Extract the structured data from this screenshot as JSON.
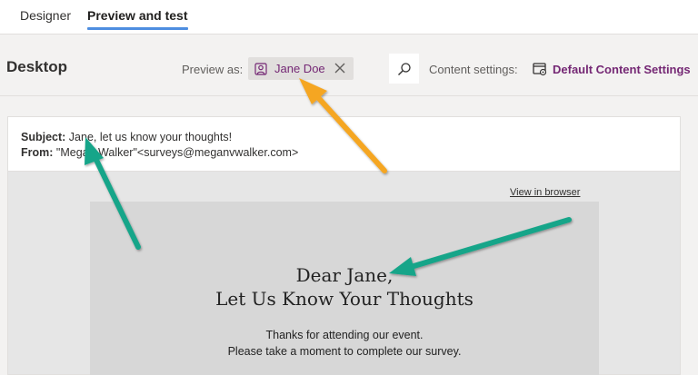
{
  "tabs": [
    {
      "label": "Designer"
    },
    {
      "label": "Preview and test",
      "active": true
    }
  ],
  "toolbar": {
    "device_title": "Desktop",
    "preview_as_label": "Preview as:",
    "persona_name": "Jane Doe",
    "content_settings_label": "Content settings:",
    "content_settings_value": "Default Content Settings"
  },
  "email": {
    "subject_label": "Subject:",
    "subject_value": "Jane, let us know your thoughts!",
    "from_label": "From:",
    "from_value": "\"Megan Walker\"<surveys@meganvwalker.com>",
    "view_in_browser": "View in browser",
    "heading_line1": "Dear Jane,",
    "heading_line2": "Let Us Know Your Thoughts",
    "body_line1": "Thanks for attending our event.",
    "body_line2": "Please take a moment to complete our survey."
  },
  "colors": {
    "accent_purple": "#742774",
    "tab_underline": "#4e8ee0",
    "arrow_orange": "#f5a623",
    "arrow_green": "#17a589"
  },
  "icons": {
    "persona": "person-icon",
    "close": "close-icon",
    "search": "search-icon",
    "settings": "content-settings-icon"
  }
}
